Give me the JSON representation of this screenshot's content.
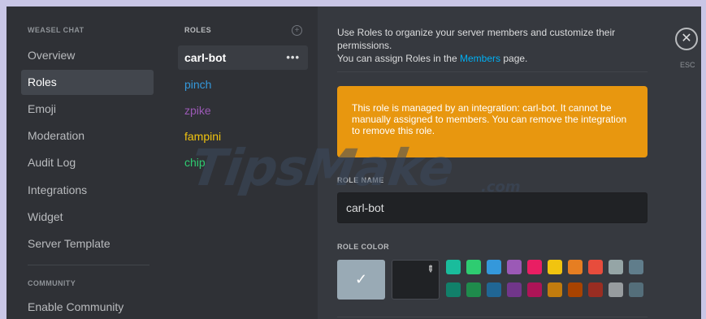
{
  "sidebar": {
    "header": "WEASEL CHAT",
    "items": [
      {
        "label": "Overview"
      },
      {
        "label": "Roles"
      },
      {
        "label": "Emoji"
      },
      {
        "label": "Moderation"
      },
      {
        "label": "Audit Log"
      },
      {
        "label": "Integrations"
      },
      {
        "label": "Widget"
      },
      {
        "label": "Server Template"
      }
    ],
    "active_item": "Roles",
    "community_header": "COMMUNITY",
    "community_items": [
      {
        "label": "Enable Community"
      }
    ]
  },
  "roles": {
    "header": "ROLES",
    "add_icon": "plus-circle-icon",
    "more_icon": "ellipsis-icon",
    "items": [
      {
        "label": "carl-bot",
        "color": "#ffffff"
      },
      {
        "label": "pinch",
        "color": "#3498db"
      },
      {
        "label": "zpike",
        "color": "#9b59b6"
      },
      {
        "label": "fampini",
        "color": "#f1c40f"
      },
      {
        "label": "chip",
        "color": "#2ecc71"
      }
    ],
    "active_item": "carl-bot"
  },
  "main": {
    "intro_text_1": "Use Roles to organize your server members and customize their permissions.",
    "intro_text_2": "You can assign Roles in the",
    "intro_link": "Members",
    "intro_text_3": "page.",
    "close_icon": "close-icon",
    "esc_label": "ESC",
    "notice": "This role is managed by an integration: carl-bot. It cannot be manually assigned to members. You can remove the integration to remove this role.",
    "notice_color": "#e8970f",
    "role_name_label": "ROLE NAME",
    "role_name_value": "carl-bot",
    "role_color_label": "ROLE COLOR",
    "default_color": "#99aab5",
    "check_icon": "check-icon",
    "eyedropper_icon": "eyedropper-icon",
    "palette": [
      [
        "#1abc9c",
        "#2ecc71",
        "#3498db",
        "#9b59b6",
        "#e91e63",
        "#f1c40f",
        "#e67e22",
        "#e74c3c",
        "#95a5a6",
        "#607d8b"
      ],
      [
        "#11806a",
        "#1f8b4c",
        "#206694",
        "#71368a",
        "#ad1457",
        "#c27c0e",
        "#a84300",
        "#992d22",
        "#979c9f",
        "#546e7a"
      ]
    ]
  },
  "watermark": {
    "text": "TipsMake",
    "suffix": ".com"
  }
}
